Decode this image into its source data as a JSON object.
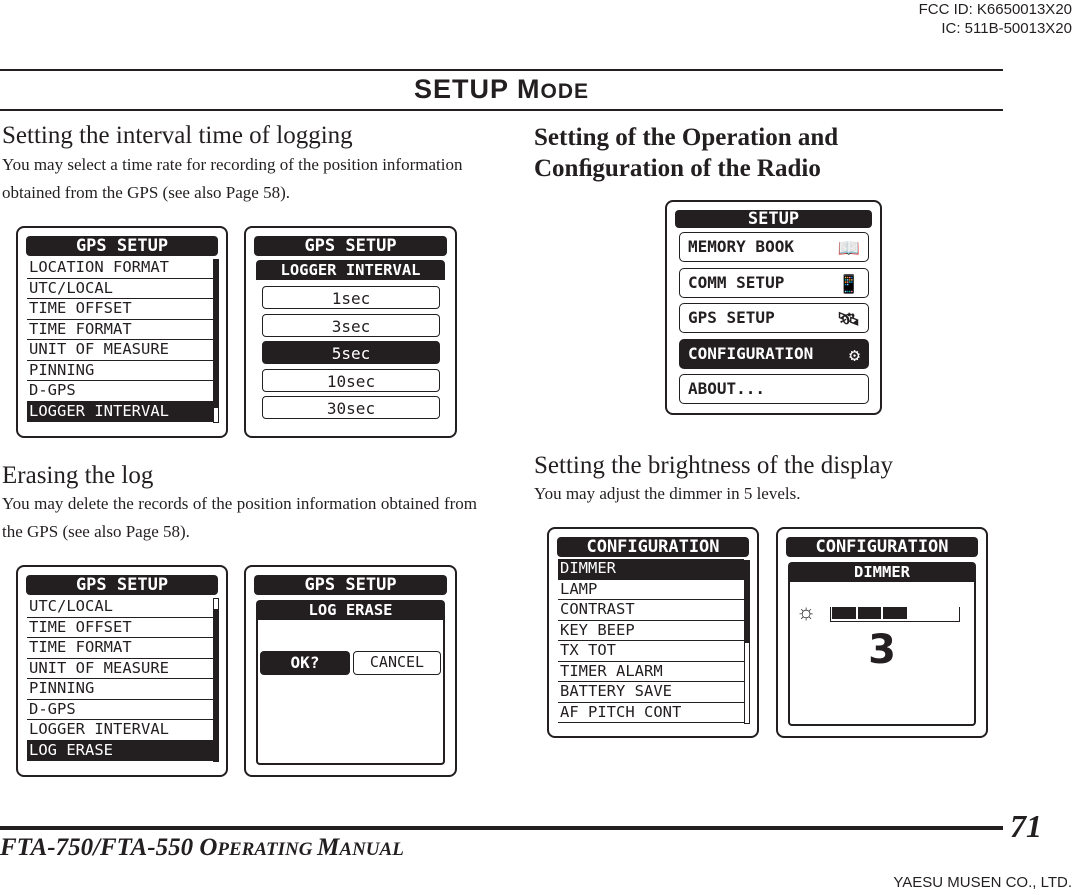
{
  "header": {
    "fcc_id": "FCC ID: K6650013X20",
    "ic": "IC: 511B-50013X20",
    "section_title_a": "SETUP M",
    "section_title_b": "ODE"
  },
  "left": {
    "s1": {
      "heading": "Setting the interval time of logging",
      "text": "You may select a time rate for recording of the position information obtained from the GPS (see also Page 58)."
    },
    "screen1": {
      "title": "GPS SETUP",
      "items": [
        "LOCATION FORMAT",
        "UTC/LOCAL",
        "TIME OFFSET",
        "TIME FORMAT",
        "UNIT OF MEASURE",
        "PINNING",
        "D-GPS",
        "LOGGER INTERVAL"
      ],
      "selected": 7
    },
    "screen2": {
      "title": "GPS SETUP",
      "subtitle": "LOGGER INTERVAL",
      "options": [
        "1sec",
        "3sec",
        "5sec",
        "10sec",
        "30sec"
      ],
      "selected": 2
    },
    "s2": {
      "heading": "Erasing the log",
      "text": "You may delete the records of the position information obtained from the GPS (see also Page 58)."
    },
    "screen3": {
      "title": "GPS SETUP",
      "items": [
        "UTC/LOCAL",
        "TIME OFFSET",
        "TIME FORMAT",
        "UNIT OF MEASURE",
        "PINNING",
        "D-GPS",
        "LOGGER INTERVAL",
        "LOG ERASE"
      ],
      "selected": 7
    },
    "screen4": {
      "title": "GPS SETUP",
      "subtitle": "LOG ERASE",
      "ok": "OK?",
      "cancel": "CANCEL"
    }
  },
  "right": {
    "s1": {
      "heading_line1": "Setting of the Operation and",
      "heading_line2": "Conﬁguration of the Radio"
    },
    "setup_screen": {
      "title": "SETUP",
      "items": [
        {
          "label": "MEMORY BOOK",
          "icon": "book-icon"
        },
        {
          "label": "COMM SETUP",
          "icon": "radio-icon"
        },
        {
          "label": "GPS SETUP",
          "icon": "satellite-icon"
        },
        {
          "label": "CONFIGURATION",
          "icon": "gear-icon"
        },
        {
          "label": "ABOUT...",
          "icon": ""
        }
      ],
      "selected": 3
    },
    "s2": {
      "heading": "Setting the brightness of the display",
      "text": "You may adjust the dimmer in 5 levels."
    },
    "screen5": {
      "title": "CONFIGURATION",
      "items": [
        "DIMMER",
        "LAMP",
        "CONTRAST",
        "KEY BEEP",
        "TX TOT",
        "TIMER ALARM",
        "BATTERY SAVE",
        "AF PITCH CONT"
      ],
      "selected": 0
    },
    "screen6": {
      "title": "CONFIGURATION",
      "subtitle": "DIMMER",
      "value": "3",
      "level": 3,
      "max_level": 5
    }
  },
  "footer": {
    "manual_a": "FTA-750/FTA-550 O",
    "manual_b": "PERATING ",
    "manual_c": "M",
    "manual_d": "ANUAL",
    "page": "71",
    "company": "YAESU MUSEN CO., LTD."
  }
}
